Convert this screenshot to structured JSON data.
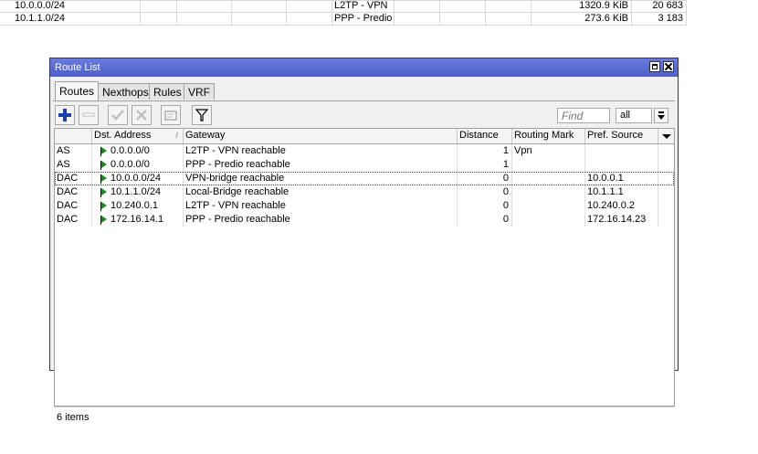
{
  "background_rows": [
    {
      "network": "10.0.0.0/24",
      "interface": "L2TP - VPN",
      "size": "1320.9 KiB",
      "count": "20 683"
    },
    {
      "network": "10.1.1.0/24",
      "interface": "PPP - Predio",
      "size": "273.6 KiB",
      "count": "3 183"
    }
  ],
  "window": {
    "title": "Route List",
    "tabs": [
      "Routes",
      "Nexthops",
      "Rules",
      "VRF"
    ],
    "active_tab": "Routes",
    "find_placeholder": "Find",
    "filter_value": "all",
    "columns": [
      "",
      "Dst. Address",
      "Gateway",
      "Distance",
      "Routing Mark",
      "Pref. Source"
    ],
    "rows": [
      {
        "type": "AS",
        "dst": "0.0.0.0/0",
        "gateway": "L2TP - VPN reachable",
        "distance": "1",
        "mark": "Vpn",
        "pref": ""
      },
      {
        "type": "AS",
        "dst": "0.0.0.0/0",
        "gateway": "PPP - Predio reachable",
        "distance": "1",
        "mark": "",
        "pref": ""
      },
      {
        "type": "DAC",
        "dst": "10.0.0.0/24",
        "gateway": "VPN-bridge reachable",
        "distance": "0",
        "mark": "",
        "pref": "10.0.0.1"
      },
      {
        "type": "DAC",
        "dst": "10.1.1.0/24",
        "gateway": "Local-Bridge reachable",
        "distance": "0",
        "mark": "",
        "pref": "10.1.1.1"
      },
      {
        "type": "DAC",
        "dst": "10.240.0.1",
        "gateway": "L2TP - VPN reachable",
        "distance": "0",
        "mark": "",
        "pref": "10.240.0.2"
      },
      {
        "type": "DAC",
        "dst": "172.16.14.1",
        "gateway": "PPP - Predio reachable",
        "distance": "0",
        "mark": "",
        "pref": "172.16.14.23"
      }
    ],
    "selected_row": 2,
    "status": "6 items"
  },
  "colors": {
    "titlebar": "#5b6dd2",
    "add_icon": "#1a3fa8",
    "flag": "#1c8a1c"
  }
}
